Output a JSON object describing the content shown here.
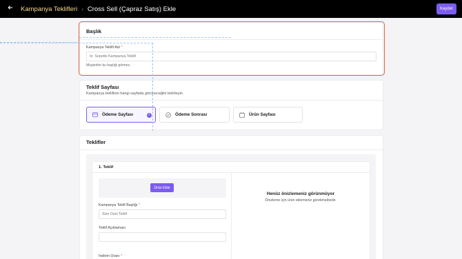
{
  "header": {
    "back_icon": "arrow-left-icon",
    "breadcrumb_parent": "Kampanya Teklifleri",
    "breadcrumb_separator": "›",
    "breadcrumb_current": "Cross Sell (Çapraz Satış) Ekle",
    "save_label": "Kaydet"
  },
  "title_card": {
    "title": "Başlık",
    "field_label": "Kampanya Teklifi Adı",
    "required_mark": "*",
    "placeholder": "ör. Sepette Kampanya Teklifi",
    "hint": "Müşteriler bu başlığı görmez."
  },
  "page_card": {
    "title": "Teklif Sayfası",
    "subtitle": "Kampanya teklifinin hangi sayfada görüneceğini belirleyin.",
    "options": [
      {
        "label": "Ödeme Sayfası",
        "icon": "credit-card-icon",
        "selected": true
      },
      {
        "label": "Ödeme Sonrası",
        "icon": "check-circle-icon",
        "selected": false
      },
      {
        "label": "Ürün Sayfası",
        "icon": "product-page-icon",
        "selected": false
      }
    ]
  },
  "offers_card": {
    "title": "Teklifler",
    "offer_title": "1. Teklif",
    "add_product_label": "Ürün Ekle",
    "offer_heading_label": "Kampanya Teklif Başlığı",
    "offer_heading_placeholder": "Size Özel Teklif",
    "description_label": "Teklif Açıklaması",
    "discount_label": "İndirim Oranı",
    "required_mark": "*",
    "preview_title": "Henüz önizlemeniz görünmüyor",
    "preview_subtitle": "Önizleme için ürün eklemeniz gerekmektedir."
  },
  "colors": {
    "accent": "#7c5cf0",
    "breadcrumb_link": "#f2d98b",
    "highlight_border": "#e0663f"
  }
}
